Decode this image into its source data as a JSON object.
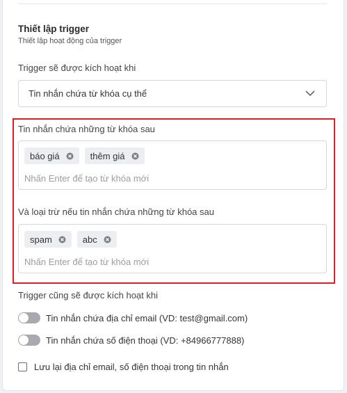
{
  "section": {
    "title": "Thiết lập trigger",
    "subtitle": "Thiết lập hoạt động của trigger"
  },
  "trigger_select": {
    "label": "Trigger sẽ được kích hoạt khi",
    "value": "Tin nhắn chứa từ khóa cụ thể"
  },
  "include_keywords": {
    "label": "Tin nhắn chứa những từ khóa sau",
    "tags": [
      "báo giá",
      "thêm giá"
    ],
    "placeholder": "Nhấn Enter để tạo từ khóa mới"
  },
  "exclude_keywords": {
    "label": "Và loại trừ nếu tin nhắn chứa những từ khóa sau",
    "tags": [
      "spam",
      "abc"
    ],
    "placeholder": "Nhấn Enter để tạo từ khóa mới"
  },
  "also_trigger": {
    "label": "Trigger cũng sẽ được kích hoạt khi",
    "toggles": [
      {
        "label": "Tin nhắn chứa địa chỉ email (VD: test@gmail.com)",
        "on": false
      },
      {
        "label": "Tin nhắn chứa số điện thoại (VD: +84966777888)",
        "on": false
      }
    ]
  },
  "save_contact": {
    "label": "Lưu lại địa chỉ email, số điện thoại trong tin nhắn",
    "checked": false
  },
  "colors": {
    "highlight": "#e31b23",
    "tag_bg": "#eceef1",
    "toggle_off": "#a8aab0"
  },
  "icons": {
    "select_arrow": "chevron-down-icon",
    "tag_remove": "remove-circle-icon"
  }
}
